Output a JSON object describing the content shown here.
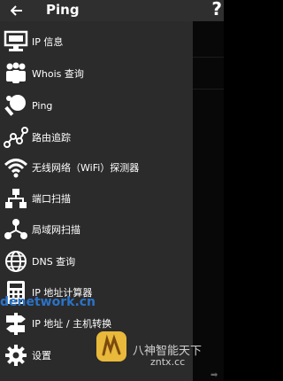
{
  "toolbar": {
    "title": "Ping",
    "help": "?"
  },
  "menu": [
    {
      "label": "IP 信息",
      "icon": "monitor-icon"
    },
    {
      "label": "Whois 查询",
      "icon": "people-icon"
    },
    {
      "label": "Ping",
      "icon": "ping-pong-icon"
    },
    {
      "label": "路由追踪",
      "icon": "route-icon"
    },
    {
      "label": "无线网络（WiFi）探测器",
      "icon": "wifi-icon"
    },
    {
      "label": "端口扫描",
      "icon": "network-tree-icon"
    },
    {
      "label": "局域网扫描",
      "icon": "lan-icon"
    },
    {
      "label": "DNS 查询",
      "icon": "globe-icon"
    },
    {
      "label": "IP 地址计算器",
      "icon": "calculator-icon"
    },
    {
      "label": "IP 地址 / 主机转换",
      "icon": "signpost-icon"
    },
    {
      "label": "设置",
      "icon": "gear-icon"
    }
  ],
  "watermark": {
    "site": "denetwork.cn",
    "cn": "八神智能天下",
    "url": "zntx.cc"
  }
}
